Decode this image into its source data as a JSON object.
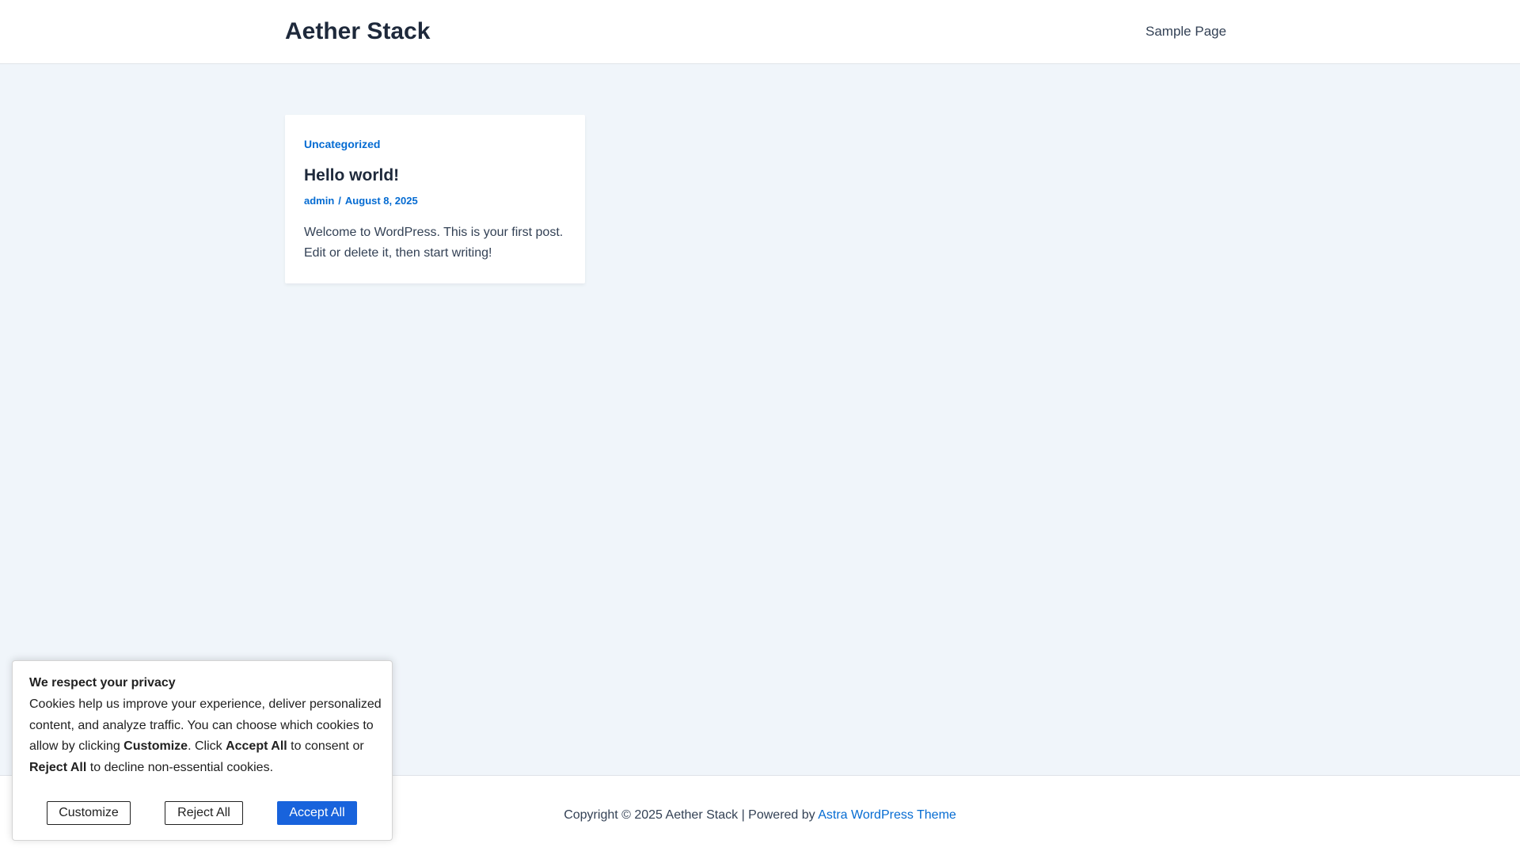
{
  "header": {
    "site_title": "Aether Stack",
    "nav_items": [
      "Sample Page"
    ]
  },
  "post": {
    "category": "Uncategorized",
    "title": "Hello world!",
    "author": "admin",
    "separator": "/",
    "date": "August 8, 2025",
    "excerpt": "Welcome to WordPress. This is your first post. Edit or delete it, then start writing!"
  },
  "footer": {
    "copyright": "Copyright © 2025 Aether Stack | Powered by ",
    "theme_link": "Astra WordPress Theme"
  },
  "cookie": {
    "title": "We respect your privacy",
    "desc_part1": "Cookies help us improve your experience, deliver personalized content, and analyze traffic. You can choose which cookies to allow by clicking ",
    "desc_customize": "Customize",
    "desc_part2": ". Click ",
    "desc_accept": "Accept All",
    "desc_part3": " to consent or ",
    "desc_reject": "Reject All",
    "desc_part4": " to decline non-essential cookies.",
    "customize_label": "Customize",
    "reject_label": "Reject All",
    "accept_label": "Accept All"
  },
  "colors": {
    "accent": "#046bd2",
    "background": "#f0f5fa",
    "heading": "#1e293b",
    "text": "#334155",
    "accept_button": "#1863dc"
  }
}
